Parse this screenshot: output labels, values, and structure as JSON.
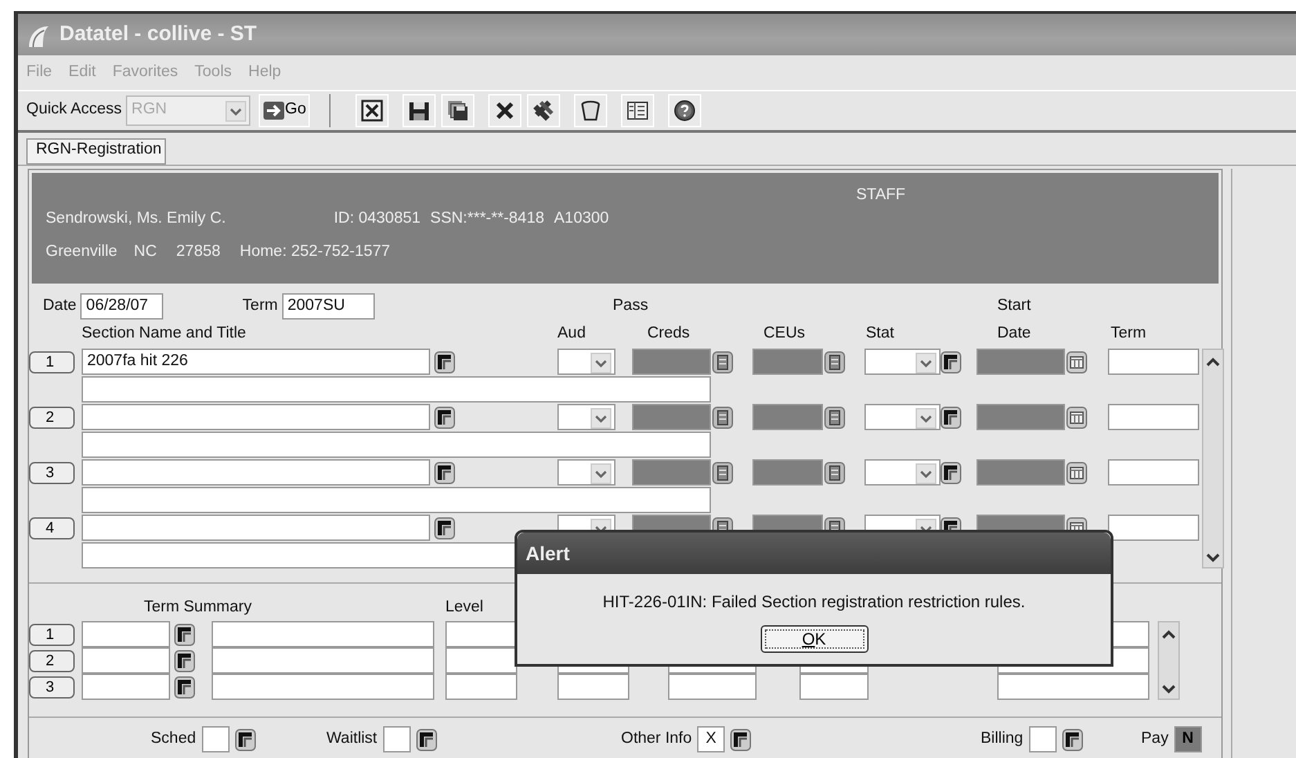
{
  "window": {
    "title": "Datatel - collive - ST"
  },
  "menu": [
    {
      "label": "File",
      "disabled": true
    },
    {
      "label": "Edit",
      "disabled": true
    },
    {
      "label": "Favorites",
      "disabled": true
    },
    {
      "label": "Tools",
      "disabled": true
    },
    {
      "label": "Help",
      "disabled": true
    }
  ],
  "toolbar": {
    "quick_access": {
      "label": "Quick Access",
      "value": "RGN",
      "disabled": true
    },
    "go": "Go",
    "buttons": [
      {
        "kind": "close"
      },
      {
        "kind": "save"
      },
      {
        "kind": "save-all"
      },
      {
        "kind": "delete"
      },
      {
        "kind": "delete-all"
      },
      {
        "kind": "trash"
      },
      {
        "kind": "panel"
      },
      {
        "kind": "help"
      }
    ]
  },
  "tabs": [
    {
      "label": "RGN-Registration",
      "selected": true
    }
  ],
  "header": {
    "badge": "STAFF",
    "name": "Sendrowski, Ms. Emily C.",
    "id": "ID: 0430851",
    "ssn": "SSN:***-**-8418",
    "code": "A10300",
    "city": "Greenville",
    "state": "NC",
    "zip": "27858",
    "phone": "Home: 252-752-1577"
  },
  "date": {
    "label": "Date",
    "value": "06/28/07"
  },
  "term": {
    "label": "Term",
    "value": "2007SU"
  },
  "columns": {
    "section": "Section Name and Title",
    "pass": "Pass",
    "aud": "Aud",
    "creds": "Creds",
    "ceus": "CEUs",
    "stat": "Stat",
    "start": "Start",
    "date": "Date",
    "term": "Term"
  },
  "sections": [
    {
      "number": "1",
      "section": "2007fa hit 226"
    },
    {
      "number": "2"
    },
    {
      "number": "3"
    },
    {
      "number": "4"
    }
  ],
  "term_summary": {
    "label": "Term Summary",
    "level_label": "Level",
    "rows": [
      {
        "number": "1"
      },
      {
        "number": "2"
      },
      {
        "number": "3"
      }
    ]
  },
  "footer": [
    {
      "kind": "lookup",
      "label": "Sched"
    },
    {
      "kind": "lookup",
      "label": "Waitlist"
    },
    {
      "kind": "lookup",
      "label": "Other Info",
      "value": "X"
    },
    {
      "kind": "lookup",
      "label": "Billing"
    },
    {
      "kind": "flag",
      "label": "Pay",
      "value": "N"
    }
  ],
  "alert": {
    "title": "Alert",
    "message": "HIT-226-01IN: Failed Section registration restriction rules.",
    "button": "OK"
  }
}
